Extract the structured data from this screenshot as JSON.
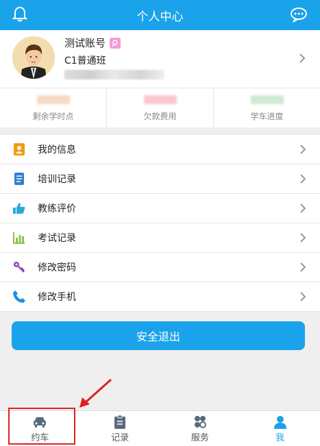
{
  "header": {
    "title": "个人中心",
    "left_icon": "bell-icon",
    "right_icon": "chat-icon"
  },
  "profile": {
    "name": "测试账号",
    "class_name": "C1普通班",
    "avatar_icon": "user-avatar"
  },
  "stats": [
    {
      "label": "剩余学时点",
      "blur_color": "#f7d9c2"
    },
    {
      "label": "欠款费用",
      "blur_color": "#f8c7d2"
    },
    {
      "label": "学车进度",
      "blur_color": "#cfe9d2"
    }
  ],
  "menu": [
    {
      "label": "我的信息",
      "icon": "contact-card-icon",
      "color": "#f39c12"
    },
    {
      "label": "培训记录",
      "icon": "document-icon",
      "color": "#2f7fd6"
    },
    {
      "label": "教练评价",
      "icon": "thumbs-up-icon",
      "color": "#2aa9d8"
    },
    {
      "label": "考试记录",
      "icon": "bar-chart-icon",
      "color": "#8bc34a"
    },
    {
      "label": "修改密码",
      "icon": "key-icon",
      "color": "#8e44ad"
    },
    {
      "label": "修改手机",
      "icon": "phone-icon",
      "color": "#1f8ee0"
    }
  ],
  "logout_label": "安全退出",
  "tabs": [
    {
      "label": "约车",
      "icon": "car-icon",
      "active": false
    },
    {
      "label": "记录",
      "icon": "clipboard-icon",
      "active": false
    },
    {
      "label": "服务",
      "icon": "clover-icon",
      "active": false
    },
    {
      "label": "我",
      "icon": "person-icon",
      "active": true
    }
  ],
  "colors": {
    "accent": "#1aa3ea",
    "annotation": "#e02020"
  }
}
